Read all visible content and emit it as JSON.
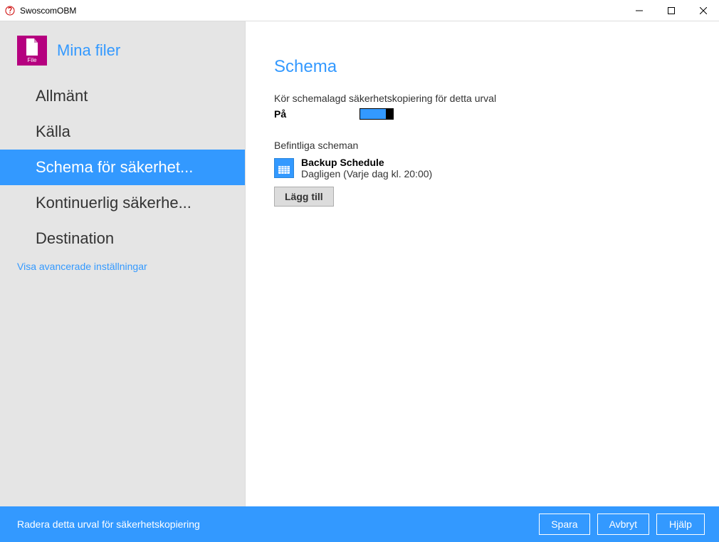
{
  "window": {
    "title": "SwoscomOBM"
  },
  "sidebar": {
    "header_icon_label": "File",
    "header_title": "Mina filer",
    "items": [
      {
        "label": "Allmänt",
        "selected": false
      },
      {
        "label": "Källa",
        "selected": false
      },
      {
        "label": "Schema för säkerhet...",
        "selected": true
      },
      {
        "label": "Kontinuerlig säkerhe...",
        "selected": false
      },
      {
        "label": "Destination",
        "selected": false
      }
    ],
    "advanced_link": "Visa avancerade inställningar"
  },
  "content": {
    "page_title": "Schema",
    "run_scheduled_text": "Kör schemalagd säkerhetskopiering för detta urval",
    "toggle_label": "På",
    "toggle_on": true,
    "existing_heading": "Befintliga scheman",
    "schedules": [
      {
        "name": "Backup Schedule",
        "desc": "Dagligen (Varje dag kl. 20:00)"
      }
    ],
    "add_button": "Lägg till"
  },
  "footer": {
    "delete_text": "Radera detta urval för säkerhetskopiering",
    "save": "Spara",
    "cancel": "Avbryt",
    "help": "Hjälp"
  }
}
